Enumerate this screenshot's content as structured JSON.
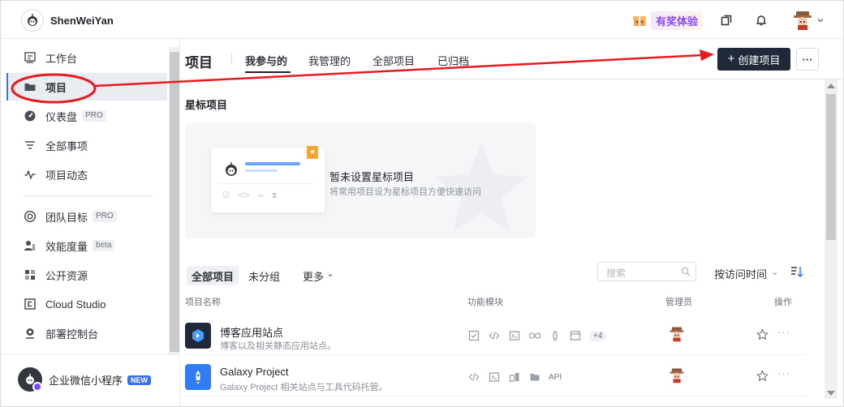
{
  "topbar": {
    "org_name": "ShenWeiYan",
    "promo": "有奖体验",
    "icons": [
      "org-logo-icon",
      "copy-window-icon",
      "bell-icon",
      "user-avatar-icon",
      "chevron-down-icon"
    ]
  },
  "sidebar": {
    "items": [
      {
        "label": "工作台",
        "icon": "workbench-icon"
      },
      {
        "label": "项目",
        "icon": "folder-icon",
        "active": true
      },
      {
        "label": "仪表盘",
        "icon": "dashboard-icon",
        "badge": "PRO"
      },
      {
        "label": "全部事项",
        "icon": "filter-list-icon"
      },
      {
        "label": "项目动态",
        "icon": "activity-icon"
      },
      {
        "label": "团队目标",
        "icon": "target-icon",
        "badge": "PRO"
      },
      {
        "label": "效能度量",
        "icon": "metrics-icon",
        "badge": "beta"
      },
      {
        "label": "公开资源",
        "icon": "resources-icon"
      },
      {
        "label": "Cloud Studio",
        "icon": "cloud-studio-icon"
      },
      {
        "label": "部署控制台",
        "icon": "deploy-icon"
      }
    ],
    "bottom": {
      "label": "企业微信小程序",
      "badge": "NEW"
    }
  },
  "header": {
    "title": "项目",
    "tabs": [
      "我参与的",
      "我管理的",
      "全部项目",
      "已归档"
    ],
    "active_tab": "我参与的",
    "create_button": "创建项目",
    "more_button": "···"
  },
  "starred": {
    "title": "星标项目",
    "empty_title": "暂未设置星标项目",
    "empty_sub": "将常用项目设为星标项目方便快速访问"
  },
  "projects": {
    "filters": [
      "全部项目",
      "未分组",
      "更多"
    ],
    "active_filter": "全部项目",
    "search_placeholder": "搜索",
    "sort_label": "按访问时间",
    "columns": [
      "项目名称",
      "功能模块",
      "管理员",
      "操作"
    ],
    "rows": [
      {
        "name": "博客应用站点",
        "desc": "博客以及相关静态应用站点。",
        "modules_more": "+4",
        "icon_color": "#1f2937"
      },
      {
        "name": "Galaxy Project",
        "desc": "Galaxy Project 相关站点与工具代码托管。",
        "api": "API",
        "icon_color": "#2f7cf6"
      }
    ]
  },
  "colors": {
    "accent": "#3471f5",
    "primary_button": "#1f2937",
    "annotation": "#e8191f"
  }
}
